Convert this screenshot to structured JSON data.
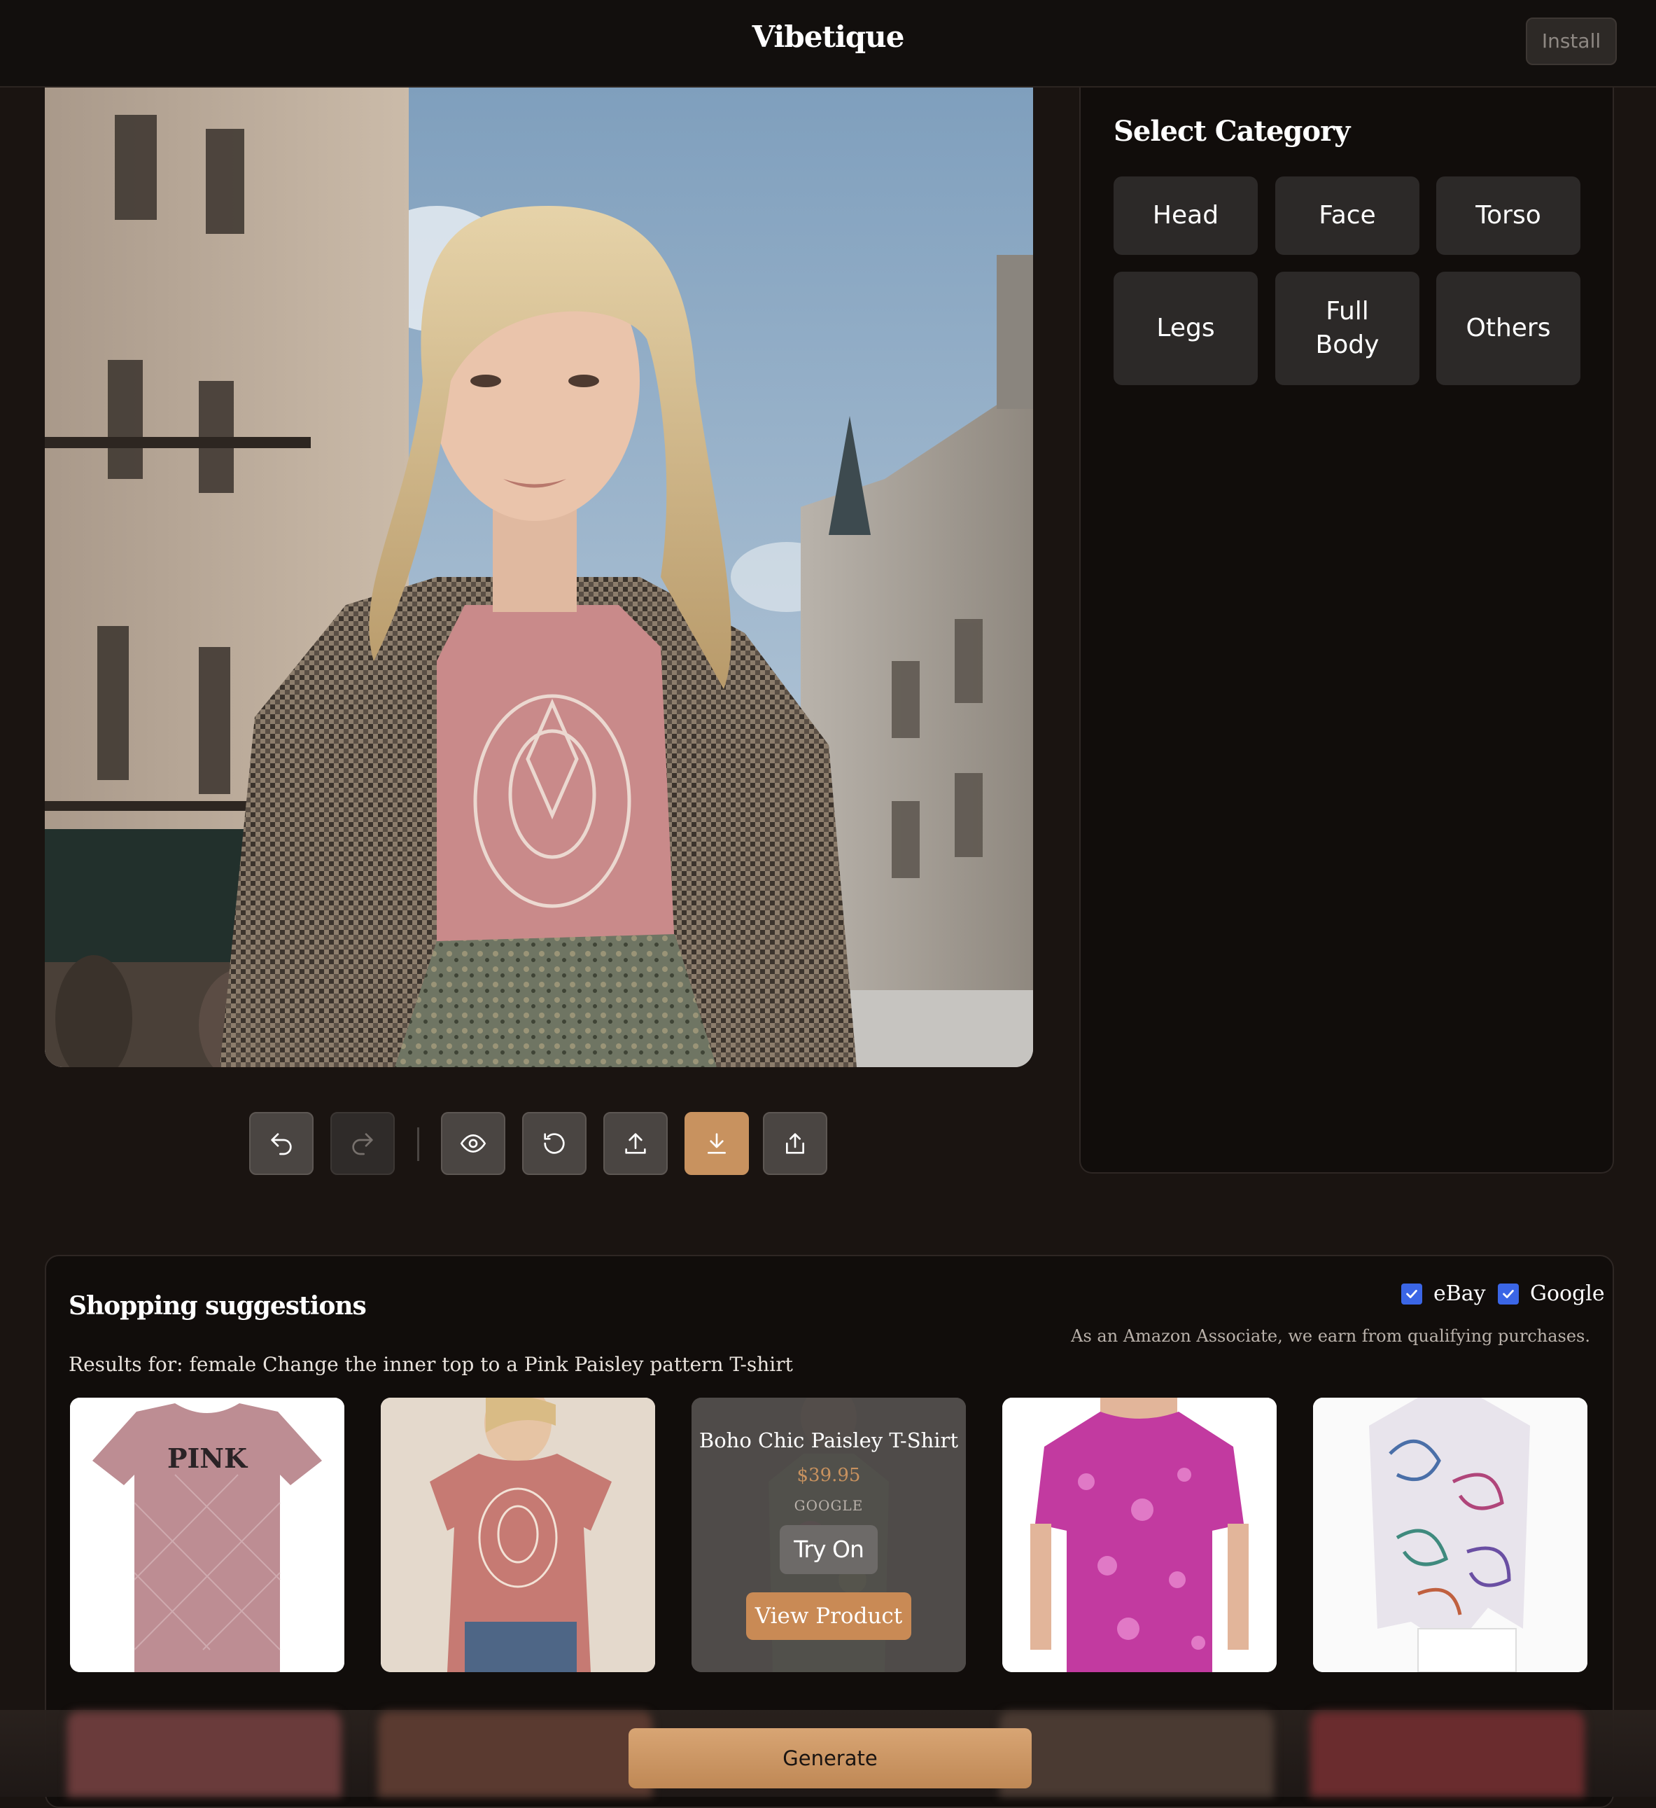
{
  "app": {
    "title": "Vibetique",
    "install_label": "Install"
  },
  "categories": {
    "title": "Select Category",
    "items": [
      {
        "label": "Head"
      },
      {
        "label": "Face"
      },
      {
        "label": "Torso"
      },
      {
        "label": "Legs"
      },
      {
        "label": "Full Body"
      },
      {
        "label": "Others"
      }
    ]
  },
  "toolbar": [
    {
      "icon": "undo-icon",
      "enabled": true
    },
    {
      "icon": "redo-icon",
      "enabled": false
    },
    {
      "icon": "eye-icon",
      "enabled": true
    },
    {
      "icon": "reset-icon",
      "enabled": true
    },
    {
      "icon": "upload-icon",
      "enabled": true
    },
    {
      "icon": "download-icon",
      "enabled": true,
      "accent": "#c8925f"
    },
    {
      "icon": "share-icon",
      "enabled": true
    }
  ],
  "shopping": {
    "title": "Shopping suggestions",
    "sources": [
      {
        "label": "eBay",
        "checked": true
      },
      {
        "label": "Google",
        "checked": true
      }
    ],
    "disclaimer": "As an Amazon Associate, we earn from qualifying purchases.",
    "results_label": "Results for: female Change the inner top to a Pink Paisley pattern T-shirt",
    "products": [
      {
        "image": "pink-tshirt-image",
        "print": "PINK"
      },
      {
        "image": "rose-mandala-tshirt-image"
      },
      {
        "image": "boho-paisley-tshirt-image",
        "title": "Boho Chic Paisley T-Shirt",
        "price": "$39.95",
        "source": "GOOGLE",
        "try_on_label": "Try On",
        "view_label": "View Product"
      },
      {
        "image": "magenta-paisley-top-image"
      },
      {
        "image": "multicolor-paisley-blouse-image"
      }
    ]
  },
  "generate_label": "Generate",
  "colors": {
    "accent": "#c8925f",
    "background": "#1a1411",
    "checkbox": "#3b66e6"
  }
}
